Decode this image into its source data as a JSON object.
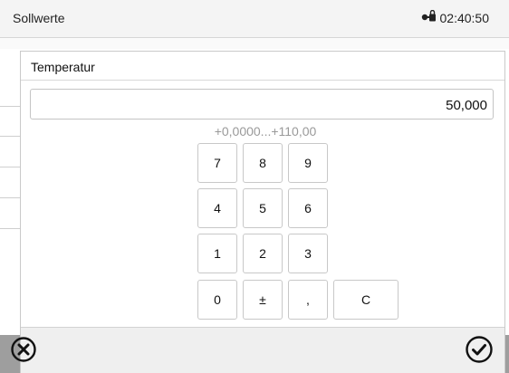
{
  "topbar": {
    "title": "Sollwerte",
    "time": "02:40:50",
    "lock_icon": "lock-key-icon"
  },
  "dialog": {
    "title": "Temperatur",
    "value": "50,000",
    "range": "+0,0000...+110,00",
    "keys": {
      "k7": "7",
      "k8": "8",
      "k9": "9",
      "k4": "4",
      "k5": "5",
      "k6": "6",
      "k1": "1",
      "k2": "2",
      "k3": "3",
      "k0": "0",
      "sign": "±",
      "comma": ",",
      "clear": "C"
    },
    "cancel_icon": "cancel-circle-x-icon",
    "confirm_icon": "confirm-circle-check-icon"
  }
}
